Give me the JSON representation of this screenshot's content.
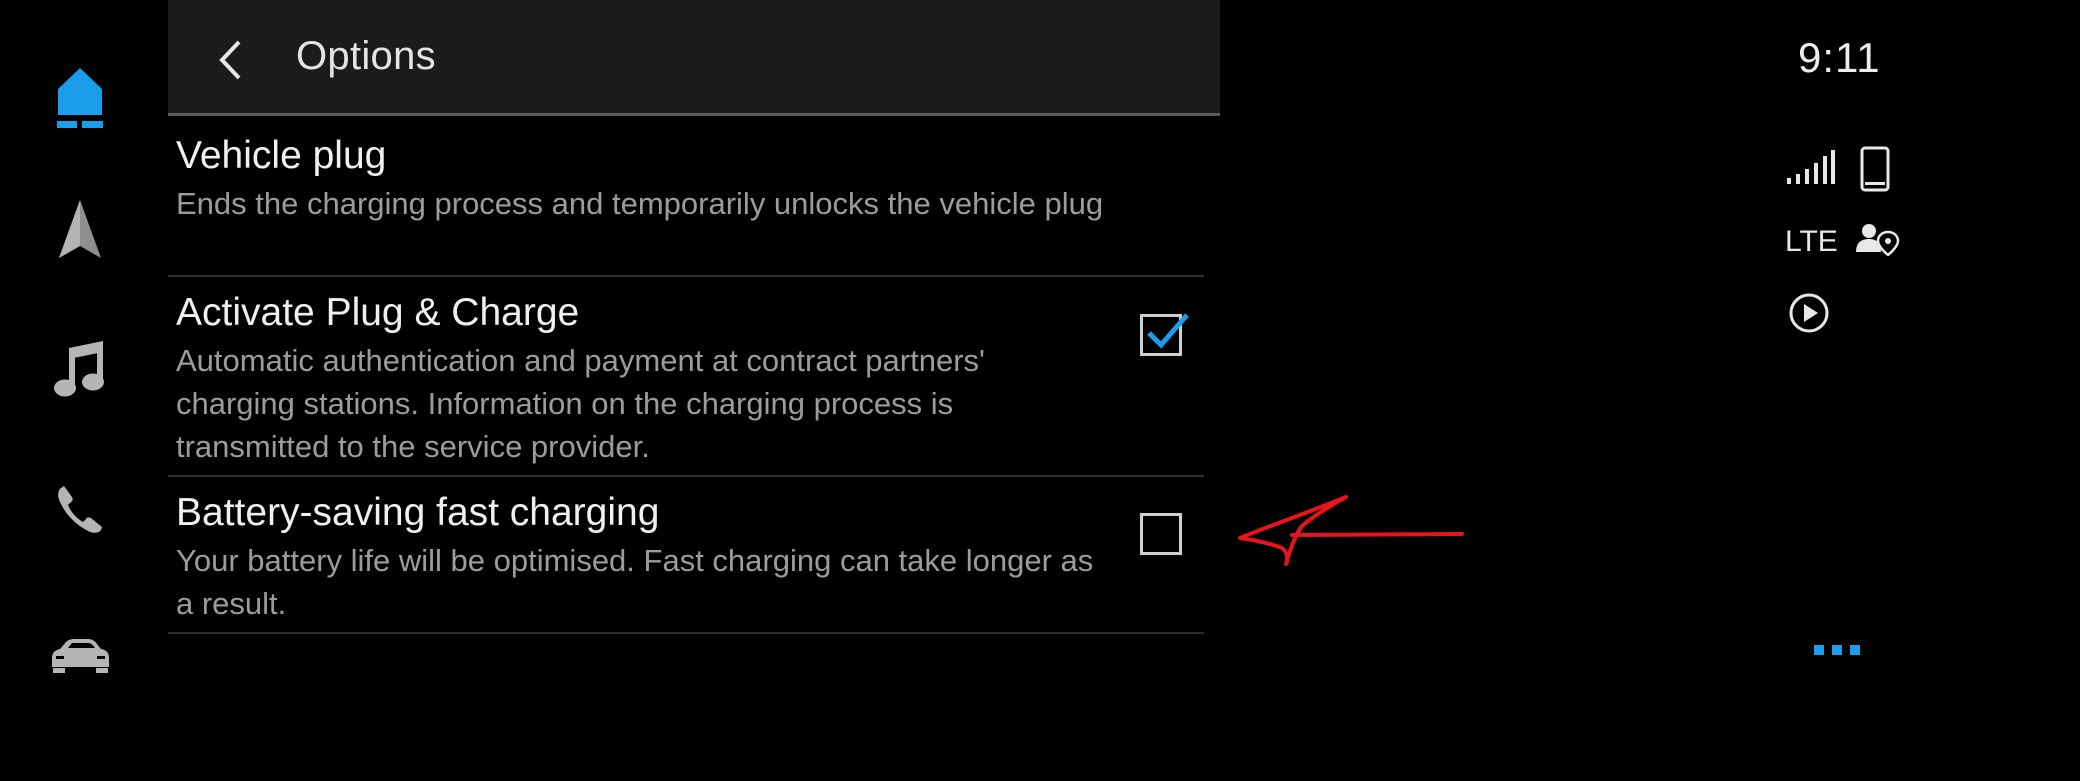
{
  "header": {
    "title": "Options"
  },
  "nav": {
    "items": [
      {
        "name": "home",
        "icon": "home-icon",
        "active": true
      },
      {
        "name": "navigation",
        "icon": "navigation-arrow-icon",
        "active": false
      },
      {
        "name": "media",
        "icon": "music-note-icon",
        "active": false
      },
      {
        "name": "phone",
        "icon": "phone-icon",
        "active": false
      },
      {
        "name": "car",
        "icon": "car-icon",
        "active": false
      }
    ]
  },
  "options": [
    {
      "title": "Vehicle plug",
      "description": "Ends the charging process and temporarily unlocks the vehicle plug",
      "has_checkbox": false
    },
    {
      "title": "Activate Plug & Charge",
      "description": "Automatic authentication and payment at contract partners' charging stations. Information on the charging process is transmitted to the service provider.",
      "has_checkbox": true,
      "checked": true
    },
    {
      "title": "Battery-saving fast charging",
      "description": "Your battery life will be optimised. Fast charging can take longer as a result.",
      "has_checkbox": true,
      "checked": false
    }
  ],
  "status": {
    "time": "9:11",
    "network": "LTE",
    "icons": [
      "signal-strength-icon",
      "smartphone-icon",
      "location-share-icon",
      "play-circle-icon"
    ]
  },
  "colors": {
    "accent": "#1a9dea",
    "background": "#000000",
    "header_bg": "#1b1b1b",
    "annotation": "#e8141b"
  }
}
